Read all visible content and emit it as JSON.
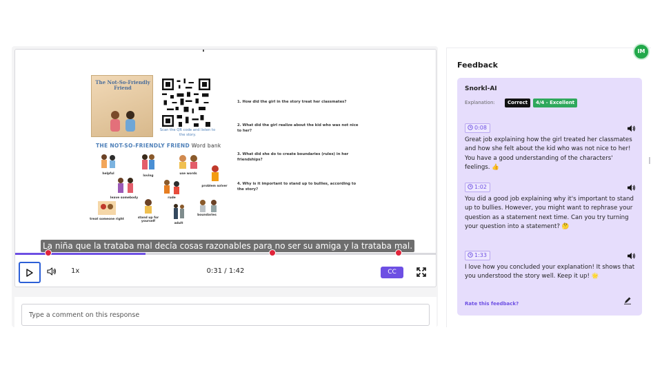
{
  "video": {
    "book_title": "The Not-So-Friendly Friend",
    "qr_caption": "Scan the QR code and listen to the story.",
    "wordbank_title": "THE NOT-SO-FRIENDLY FRIEND",
    "wordbank_suffix": "Word bank",
    "wordbank_items": [
      "helpful",
      "loving",
      "use words",
      "problem solver",
      "leave somebody",
      "rude",
      "treat someone right",
      "stand up for yourself",
      "adult",
      "boundaries"
    ],
    "questions": [
      "1. How did the girl in the story treat her classmates?",
      "2. What did the girl realize about the kid who was not nice to her?",
      "3. What did she do to create boundaries (rules) in her friendships?",
      "4. Why is it important to stand up to bullies, according to the story?"
    ],
    "subtitle": "La niña que la trataba mal decía cosas razonables para no ser su amiga y la trataba mal.",
    "progress_fraction": 0.31,
    "marker_fractions": [
      0.079,
      0.612,
      0.912
    ]
  },
  "controls": {
    "speed": "1x",
    "time": "0:31 / 1:42",
    "cc_label": "CC"
  },
  "comment": {
    "placeholder": "Type a comment on this response"
  },
  "feedback": {
    "title": "Feedback",
    "logo_text": "IM",
    "author": "Snorkl-AI",
    "explanation_label": "Explanation:",
    "correct_badge": "Correct",
    "score_badge": "4/4 - Excellent",
    "entries": [
      {
        "time": "0:08",
        "text": "Great job explaining how the girl treated her classmates and how she felt about the kid who was not nice to her! You have a good understanding of the characters' feelings. 👍"
      },
      {
        "time": "1:02",
        "text": "You did a good job explaining why it's important to stand up to bullies. However, you might want to rephrase your question as a statement next time. Can you try turning your question into a statement? 🤔"
      },
      {
        "time": "1:33",
        "text": "I love how you concluded your explanation! It shows that you understood the story well. Keep it up! 🌟"
      }
    ],
    "rate_label": "Rate this feedback?"
  },
  "colors": {
    "accent": "#6d4fe3",
    "marker": "#e0243a",
    "card_bg": "#e6ddfc",
    "correct_bg": "#111111",
    "score_bg": "#2fa85c"
  }
}
